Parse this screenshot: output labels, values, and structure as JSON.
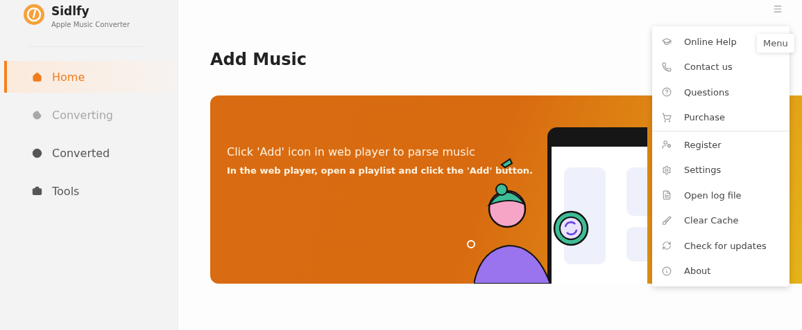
{
  "app": {
    "name": "Sidlfy",
    "subtitle": "Apple Music Converter"
  },
  "sidebar": {
    "items": [
      {
        "label": "Home",
        "selected": true,
        "disabled": false
      },
      {
        "label": "Converting",
        "selected": false,
        "disabled": true
      },
      {
        "label": "Converted",
        "selected": false,
        "disabled": false
      },
      {
        "label": "Tools",
        "selected": false,
        "disabled": false
      }
    ]
  },
  "page": {
    "title": "Add Music"
  },
  "banner": {
    "headline": "Click 'Add' icon in web player to parse music",
    "text": "In the web player, open a playlist and click the 'Add' button."
  },
  "menu": {
    "tooltip": "Menu",
    "groups": [
      [
        "Online Help",
        "Contact us",
        "Questions",
        "Purchase"
      ],
      [
        "Register",
        "Settings",
        "Open log file",
        "Clear Cache",
        "Check for updates",
        "About"
      ]
    ]
  }
}
